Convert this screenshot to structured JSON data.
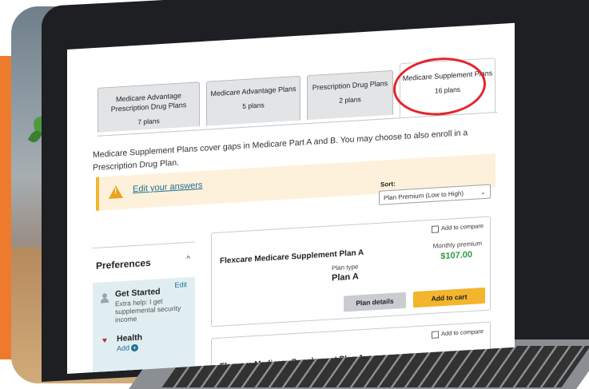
{
  "tabs": [
    {
      "label": "Medicare Advantage Prescription Drug Plans",
      "count": "7 plans"
    },
    {
      "label": "Medicare Advantage Plans",
      "count": "5 plans"
    },
    {
      "label": "Prescription Drug Plans",
      "count": "2 plans"
    },
    {
      "label": "Medicare Supplement Plans",
      "count": "16 plans"
    }
  ],
  "description": "Medicare Supplement Plans cover gaps in Medicare Part A and B. You may choose to also enroll in a Prescription Drug Plan.",
  "alert": {
    "link": "Edit your answers"
  },
  "sort": {
    "label": "Sort:",
    "value": "Plan Premium (Low to High)"
  },
  "preferences": {
    "title": "Preferences",
    "get_started": {
      "title": "Get Started",
      "edit": "Edit",
      "text": "Extra help: I get supplemental security income"
    },
    "health": {
      "title": "Health",
      "add": "Add"
    }
  },
  "plans": [
    {
      "compare": "Add to compare",
      "name": "Flexcare Medicare Supplement Plan A",
      "type_label": "Plan type",
      "type": "Plan A",
      "premium_label": "Monthly premium",
      "premium": "$107.00",
      "details_button": "Plan details",
      "cart_button": "Add to cart"
    },
    {
      "compare": "Add to compare",
      "name": "Flexcare Medicare Supplement Plan A"
    }
  ],
  "colors": {
    "accent_orange": "#ee7b2d",
    "highlight_circle": "#e3262b",
    "premium_green": "#2f9a44",
    "cart_yellow": "#f2b52b",
    "link_blue": "#1f6f93"
  }
}
